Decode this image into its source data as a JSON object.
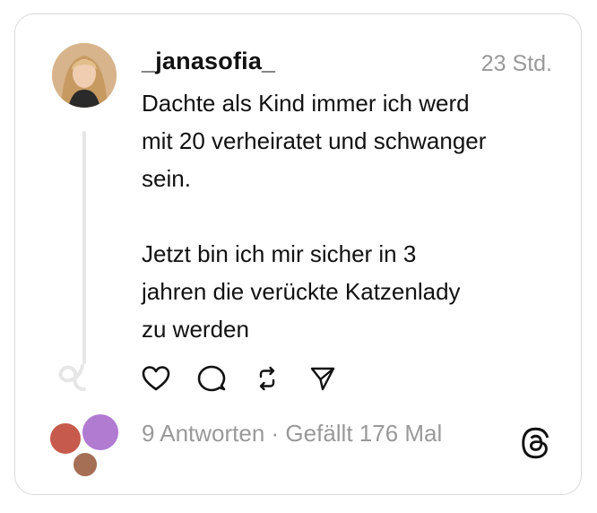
{
  "post": {
    "username": "_janasofia_",
    "time": "23 Std.",
    "paragraph1_line1": "Dachte als Kind immer ich werd",
    "paragraph1_line2": "mit 20 verheiratet und schwanger",
    "paragraph1_line3": "sein.",
    "paragraph2_line1": "Jetzt bin ich mir sicher in 3",
    "paragraph2_line2": "jahren die verückte Katzenlady",
    "paragraph2_line3": "zu werden",
    "stats": "9 Antworten · Gefällt 176 Mal"
  },
  "icons": {
    "like": "heart-icon",
    "reply": "comment-icon",
    "repost": "repost-icon",
    "share": "send-icon",
    "brand": "threads-logo-icon"
  },
  "colors": {
    "text": "#111111",
    "muted": "#999999",
    "border": "#d9d9d9"
  }
}
